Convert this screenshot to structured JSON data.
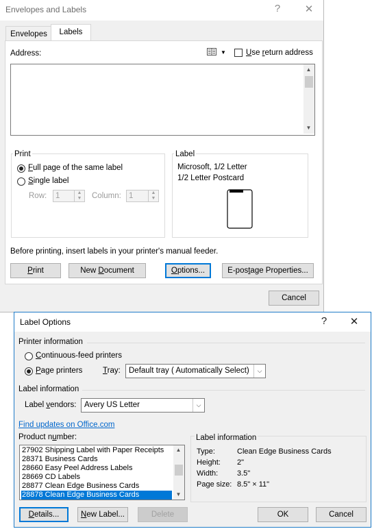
{
  "env_dialog": {
    "title": "Envelopes and Labels",
    "help_glyph": "?",
    "close_glyph": "✕",
    "tabs": [
      "Envelopes",
      "Labels"
    ],
    "address_label": "Address:",
    "use_return_address": "Use return address",
    "print_group": {
      "title": "Print",
      "full_page": "Full page of the same label",
      "single_label": "Single label",
      "row_label": "Row:",
      "row_value": "1",
      "column_label": "Column:",
      "column_value": "1"
    },
    "label_group": {
      "title": "Label",
      "line1": "Microsoft, 1/2 Letter",
      "line2": "1/2 Letter Postcard"
    },
    "manual_feeder_note": "Before printing, insert labels in your printer's manual feeder.",
    "buttons": {
      "print": "Print",
      "new_document": "New Document",
      "options": "Options...",
      "epostage": "E-postage Properties...",
      "cancel": "Cancel"
    }
  },
  "label_options": {
    "title": "Label Options",
    "help_glyph": "?",
    "close_glyph": "✕",
    "printer_info_title": "Printer information",
    "continuous_feed": "Continuous-feed printers",
    "page_printers": "Page printers",
    "tray_label": "Tray:",
    "tray_value": "Default tray ( Automatically Select)",
    "label_info_title": "Label information",
    "label_vendors_label": "Label vendors:",
    "label_vendors_value": "Avery US Letter",
    "find_updates": "Find updates on Office.com",
    "product_number_label": "Product number:",
    "products": [
      "27902 Shipping Label with Paper Receipts",
      "28371 Business Cards",
      "28660 Easy Peel Address Labels",
      "28669 CD Labels",
      "28877 Clean Edge Business Cards",
      "28878 Clean Edge Business Cards"
    ],
    "selected_product": "28878 Clean Edge Business Cards",
    "info_box": {
      "title": "Label information",
      "type_key": "Type:",
      "type_val": "Clean Edge Business Cards",
      "height_key": "Height:",
      "height_val": "2\"",
      "width_key": "Width:",
      "width_val": "3.5\"",
      "page_size_key": "Page size:",
      "page_size_val": "8.5\" × 11\""
    },
    "buttons": {
      "details": "Details...",
      "new_label": "New Label...",
      "delete": "Delete",
      "ok": "OK",
      "cancel": "Cancel"
    }
  }
}
